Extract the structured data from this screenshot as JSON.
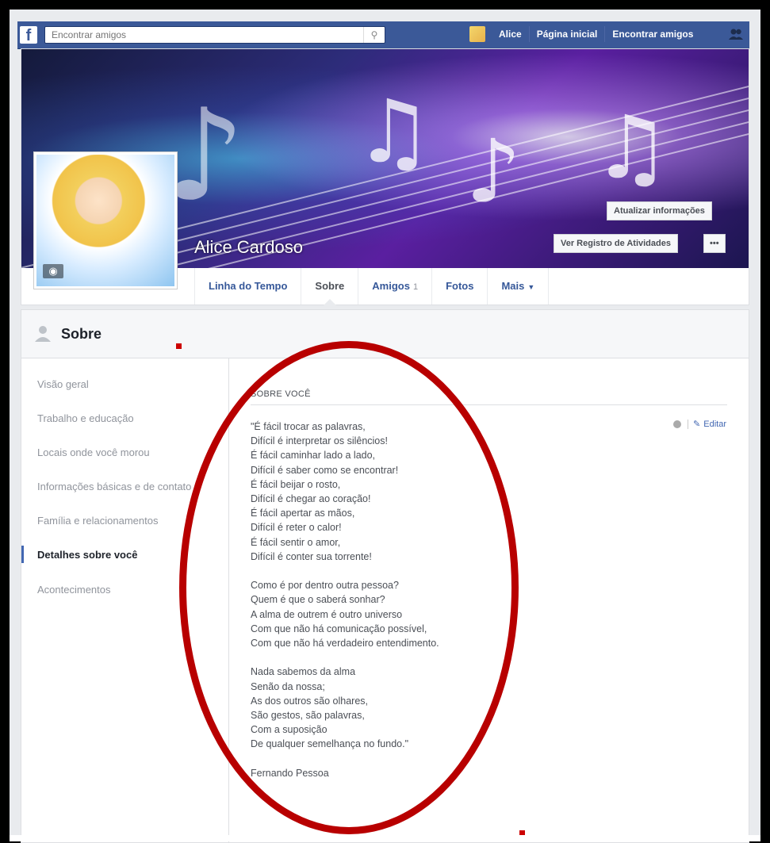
{
  "topbar": {
    "logo": "f",
    "search_placeholder": "Encontrar amigos",
    "user": "Alice",
    "links": [
      "Página inicial",
      "Encontrar amigos"
    ]
  },
  "cover": {
    "name": "Alice Cardoso",
    "update_button": "Atualizar informações",
    "activity_button": "Ver Registro de Atividades",
    "more_button": "•••"
  },
  "tabs": [
    {
      "label": "Linha do Tempo"
    },
    {
      "label": "Sobre"
    },
    {
      "label": "Amigos",
      "count": "1"
    },
    {
      "label": "Fotos"
    },
    {
      "label": "Mais"
    }
  ],
  "about": {
    "title": "Sobre",
    "sidebar": [
      "Visão geral",
      "Trabalho e educação",
      "Locais onde você morou",
      "Informações básicas e de contato",
      "Família e relacionamentos",
      "Detalhes sobre você",
      "Acontecimentos"
    ],
    "active_item": "Detalhes sobre você",
    "section_title": "SOBRE VOCÊ",
    "edit_label": "Editar",
    "poem": "\"É fácil trocar as palavras,\nDifícil é interpretar os silêncios!\nÉ fácil caminhar lado a lado,\nDifícil é saber como se encontrar!\nÉ fácil beijar o rosto,\nDifícil é chegar ao coração!\nÉ fácil apertar as mãos,\nDifícil é reter o calor!\nÉ fácil sentir o amor,\nDifícil é conter sua torrente!\n\nComo é por dentro outra pessoa?\nQuem é que o saberá sonhar?\nA alma de outrem é outro universo\nCom que não há comunicação possível,\nCom que não há verdadeiro entendimento.\n\nNada sabemos da alma\nSenão da nossa;\nAs dos outros são olhares,\nSão gestos, são palavras,\nCom a suposição\nDe qualquer semelhança no fundo.\"\n\nFernando Pessoa"
  },
  "colors": {
    "brand": "#3b5998",
    "link": "#365899",
    "annotation": "#b80000"
  }
}
